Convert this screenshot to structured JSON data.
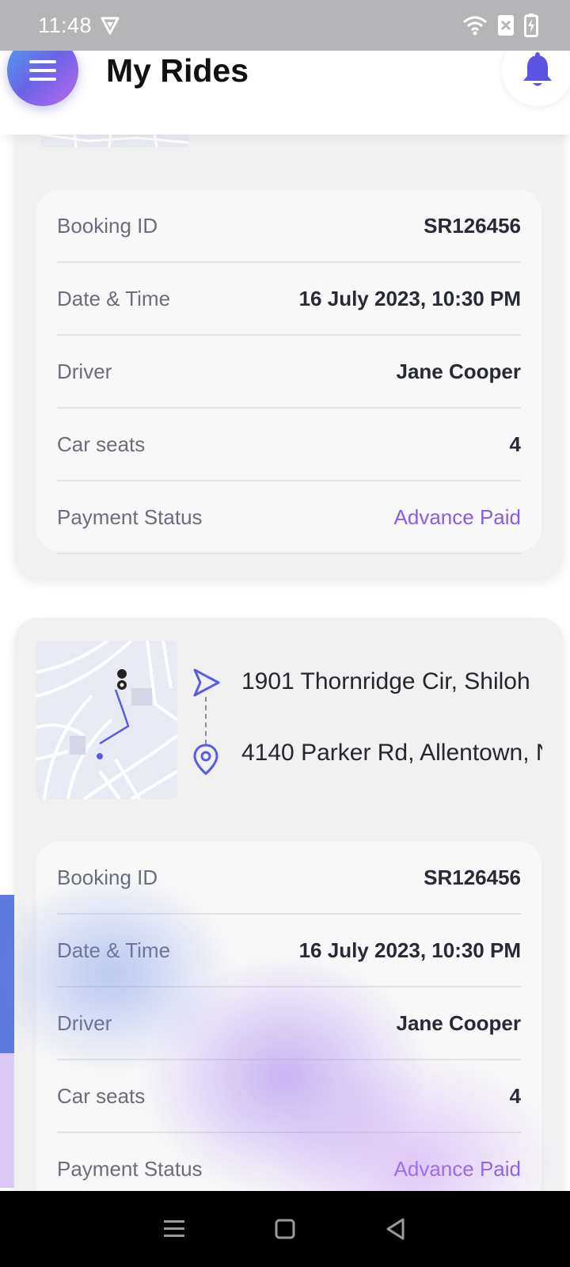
{
  "status_bar": {
    "time": "11:48"
  },
  "header": {
    "title": "My Rides"
  },
  "rides": [
    {
      "details": [
        {
          "label": "Booking ID",
          "value": "SR126456"
        },
        {
          "label": "Date & Time",
          "value": "16 July 2023, 10:30 PM"
        },
        {
          "label": "Driver",
          "value": "Jane Cooper"
        },
        {
          "label": "Car seats",
          "value": "4"
        },
        {
          "label": "Payment Status",
          "value": "Advance Paid"
        }
      ]
    },
    {
      "from": "1901 Thornridge Cir, Shiloh",
      "to": "4140 Parker Rd, Allentown, N",
      "details": [
        {
          "label": "Booking ID",
          "value": "SR126456"
        },
        {
          "label": "Date & Time",
          "value": "16 July 2023, 10:30 PM"
        },
        {
          "label": "Driver",
          "value": "Jane Cooper"
        },
        {
          "label": "Car seats",
          "value": "4"
        },
        {
          "label": "Payment Status",
          "value": "Advance Paid"
        }
      ]
    }
  ],
  "colors": {
    "accent": "#6c63e8",
    "paid": "#8a5be6",
    "route": "#5b5be6"
  }
}
